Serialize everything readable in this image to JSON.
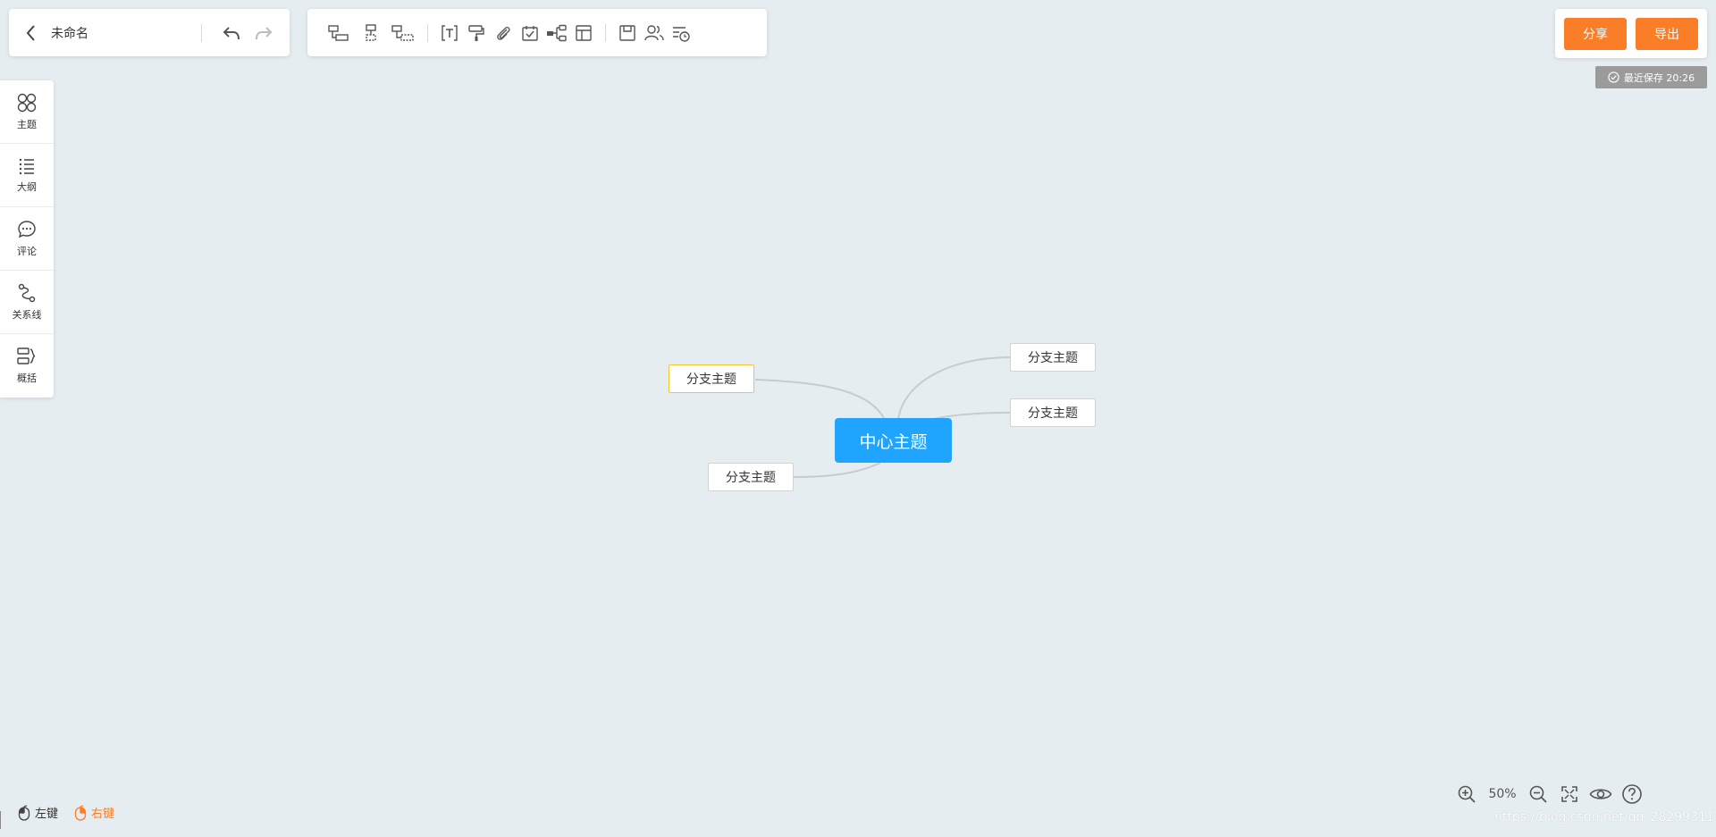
{
  "document": {
    "title": "未命名"
  },
  "header": {
    "share_label": "分享",
    "export_label": "导出",
    "save_status": "最近保存 20:26"
  },
  "toolbar": {
    "tools": [
      {
        "icon": "insert-child-topic-icon"
      },
      {
        "icon": "insert-sibling-topic-icon"
      },
      {
        "icon": "insert-parent-topic-icon"
      },
      {
        "icon": "text-icon"
      },
      {
        "icon": "format-painter-icon"
      },
      {
        "icon": "attachment-icon"
      },
      {
        "icon": "task-icon"
      },
      {
        "icon": "structure-icon"
      },
      {
        "icon": "layout-icon"
      },
      {
        "icon": "save-icon"
      },
      {
        "icon": "collaborators-icon"
      },
      {
        "icon": "history-icon"
      }
    ]
  },
  "sidebar": {
    "items": [
      {
        "label": "主题",
        "icon": "theme-icon"
      },
      {
        "label": "大纲",
        "icon": "outline-icon"
      },
      {
        "label": "评论",
        "icon": "comment-icon"
      },
      {
        "label": "关系线",
        "icon": "relation-line-icon"
      },
      {
        "label": "概括",
        "icon": "summary-icon"
      }
    ]
  },
  "mindmap": {
    "root": "中心主题",
    "branches": [
      {
        "label": "分支主题",
        "side": "left",
        "selected": true
      },
      {
        "label": "分支主题",
        "side": "left",
        "selected": false
      },
      {
        "label": "分支主题",
        "side": "right",
        "selected": false
      },
      {
        "label": "分支主题",
        "side": "right",
        "selected": false
      }
    ]
  },
  "footer": {
    "left_click": "左键",
    "right_click": "右键",
    "zoom_level": "50%",
    "watermark": "https://blog.csdn.net/qq_28299311"
  },
  "colors": {
    "accent": "#fa7d27",
    "root_node": "#1fa5ff",
    "selected_border": "#f7c531",
    "canvas": "#e6edf1"
  }
}
